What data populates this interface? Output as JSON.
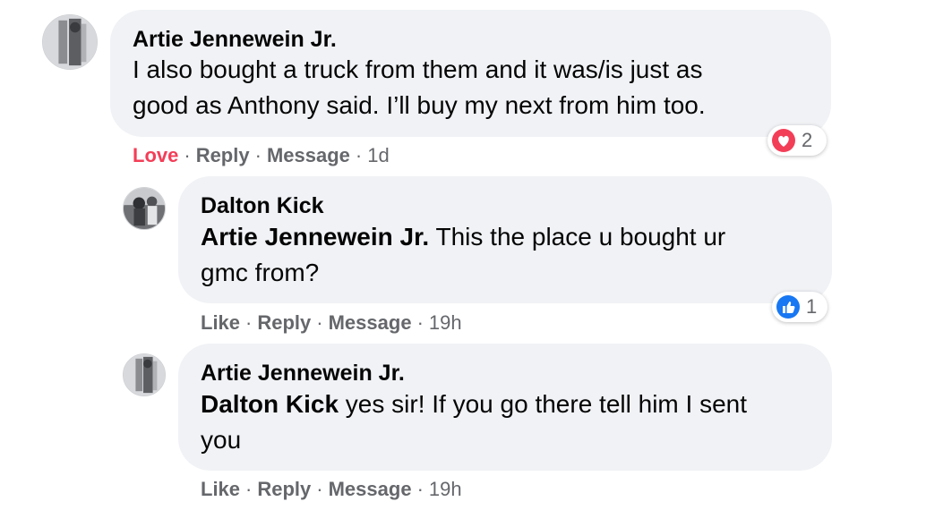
{
  "comments": [
    {
      "author": "Artie Jennewein Jr.",
      "lines": [
        "I also bought a truck from them and it was/is just as",
        "good as Anthony said. I’ll buy my next from him too."
      ],
      "actions": {
        "reaction_label": "Love",
        "reply": "Reply",
        "message": "Message",
        "time": "1d"
      },
      "reaction": {
        "icon": "heart-icon",
        "count": "2",
        "color": "#f33e58"
      }
    },
    {
      "author": "Dalton Kick",
      "mention": "Artie Jennewein Jr.",
      "line1_rest": " This the place u bought ur",
      "line2": "gmc from?",
      "actions": {
        "reaction_label": "Like",
        "reply": "Reply",
        "message": "Message",
        "time": "19h"
      },
      "reaction": {
        "icon": "thumbs-up-icon",
        "count": "1",
        "color": "#1877f2"
      }
    },
    {
      "author": "Artie Jennewein Jr.",
      "mention": "Dalton Kick",
      "line1_rest": " yes sir! If you go there tell him I sent",
      "line2": "you",
      "actions": {
        "reaction_label": "Like",
        "reply": "Reply",
        "message": "Message",
        "time": "19h"
      }
    }
  ],
  "separator": "·"
}
